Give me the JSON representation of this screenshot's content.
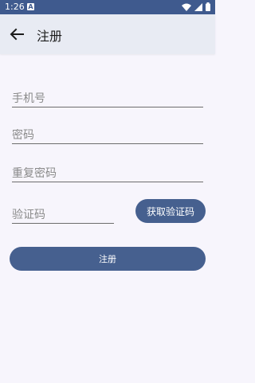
{
  "status_bar": {
    "time": "1:26",
    "app_icon": "notification-icon",
    "icons": [
      "wifi-icon",
      "signal-icon",
      "battery-icon"
    ]
  },
  "appbar": {
    "title": "注册",
    "back_icon": "arrow-left-icon"
  },
  "form": {
    "phone_placeholder": "手机号",
    "password_placeholder": "密码",
    "repeat_password_placeholder": "重复密码",
    "code_placeholder": "验证码",
    "get_code_label": "获取验证码",
    "register_label": "注册"
  },
  "colors": {
    "primary": "#46608f",
    "status_bar": "#3f5a8e",
    "appbar": "#e8ebf3",
    "background": "#f7f5fc"
  }
}
